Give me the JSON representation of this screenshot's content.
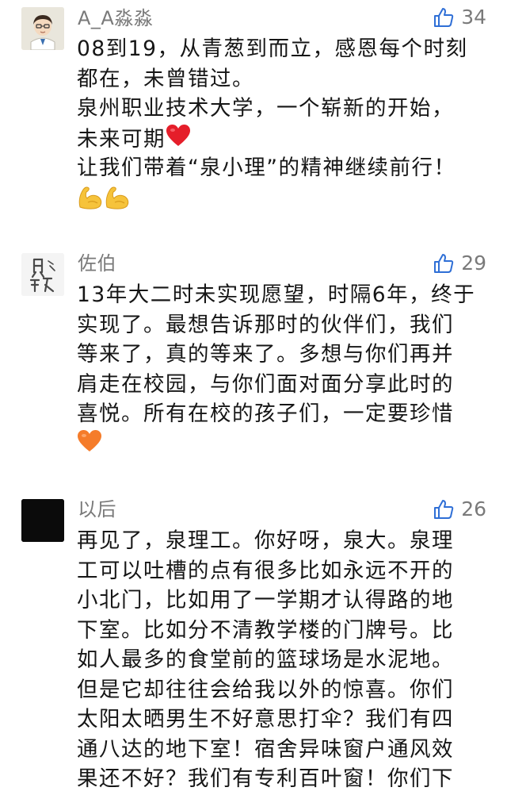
{
  "comments": [
    {
      "author": "A_A淼淼",
      "likes": "34",
      "avatar": "cartoon-avatar",
      "lines": [
        "08到19，从青葱到而立，感恩每个时刻",
        "都在，未曾错过。",
        "泉州职业技术大学，一个崭新的开始，",
        "未来可期",
        "让我们带着“泉小理”的精神继续前行！"
      ],
      "emojis": [
        "red-heart",
        "flexed-biceps",
        "flexed-biceps"
      ]
    },
    {
      "author": "佐伯",
      "likes": "29",
      "avatar": "calligraphy-avatar",
      "lines": [
        "13年大二时未实现愿望，时隔6年，终于",
        "实现了。最想告诉那时的伙伴们，我们",
        "等来了，真的等来了。多想与你们再并",
        "肩走在校园，与你们面对面分享此时的",
        "喜悦。所有在校的孩子们，一定要珍惜"
      ],
      "emojis": [
        "orange-heart"
      ]
    },
    {
      "author": "以后",
      "likes": "26",
      "avatar": "black-avatar",
      "lines": [
        "再见了，泉理工。你好呀，泉大。泉理",
        "工可以吐槽的点有很多比如永远不开的",
        "小北门，比如用了一学期才认得路的地",
        "下室。比如分不清教学楼的门牌号。比",
        "如人最多的食堂前的篮球场是水泥地。",
        "但是它却往往会给我以外的惊喜。你们",
        "太阳太晒男生不好意思打伞？我们有四",
        "通八达的地下室！宿舍异味窗户通风效",
        "果还不好？我们有专利百叶窗！你们下"
      ],
      "emojis": []
    }
  ],
  "colors": {
    "name": "#7a7a7a",
    "text": "#161616",
    "like_icon": "#2f6fd6"
  }
}
